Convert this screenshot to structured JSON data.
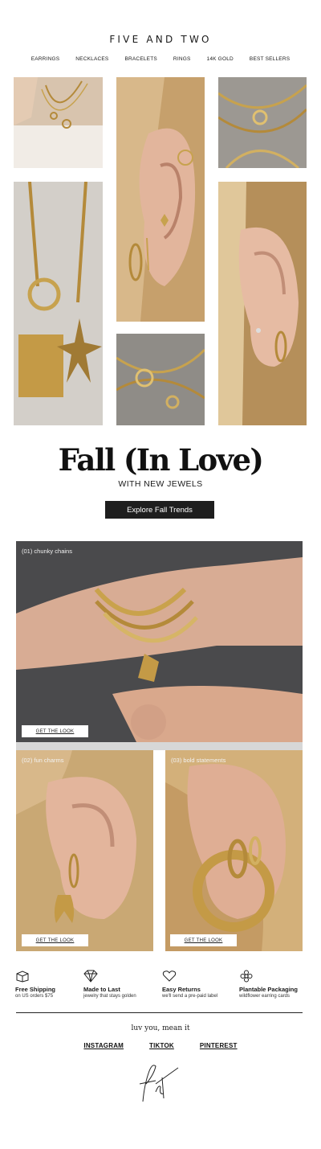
{
  "header": {
    "brand": "FIVE AND TWO",
    "nav": [
      "EARRINGS",
      "NECKLACES",
      "BRACELETS",
      "RINGS",
      "14K GOLD",
      "BEST SELLERS"
    ]
  },
  "hero": {
    "title": "Fall (In Love)",
    "subtitle": "WITH NEW JEWELS",
    "cta": "Explore Fall Trends"
  },
  "trends": [
    {
      "label": "(01) chunky chains",
      "button": "GET THE LOOK"
    },
    {
      "label": "(02) fun charms",
      "button": "GET THE LOOK"
    },
    {
      "label": "(03) bold statements",
      "button": "GET THE LOOK"
    }
  ],
  "features": [
    {
      "icon": "box-icon",
      "title": "Free Shipping",
      "subtitle": "on US orders $75"
    },
    {
      "icon": "diamond-icon",
      "title": "Made to Last",
      "subtitle": "jewelry that stays golden"
    },
    {
      "icon": "heart-icon",
      "title": "Easy Returns",
      "subtitle": "we'll send a pre-paid label"
    },
    {
      "icon": "flower-icon",
      "title": "Plantable Packaging",
      "subtitle": "wildflower earring cards"
    }
  ],
  "footer": {
    "tagline": "luv you, mean it",
    "social": [
      "INSTAGRAM",
      "TIKTOK",
      "PINTEREST"
    ],
    "signature": "f+t"
  },
  "colors": {
    "gold": "#b8913f",
    "dark_button": "#1e1e1e",
    "hair": "#c8a772",
    "skin": "#d9a88c"
  }
}
